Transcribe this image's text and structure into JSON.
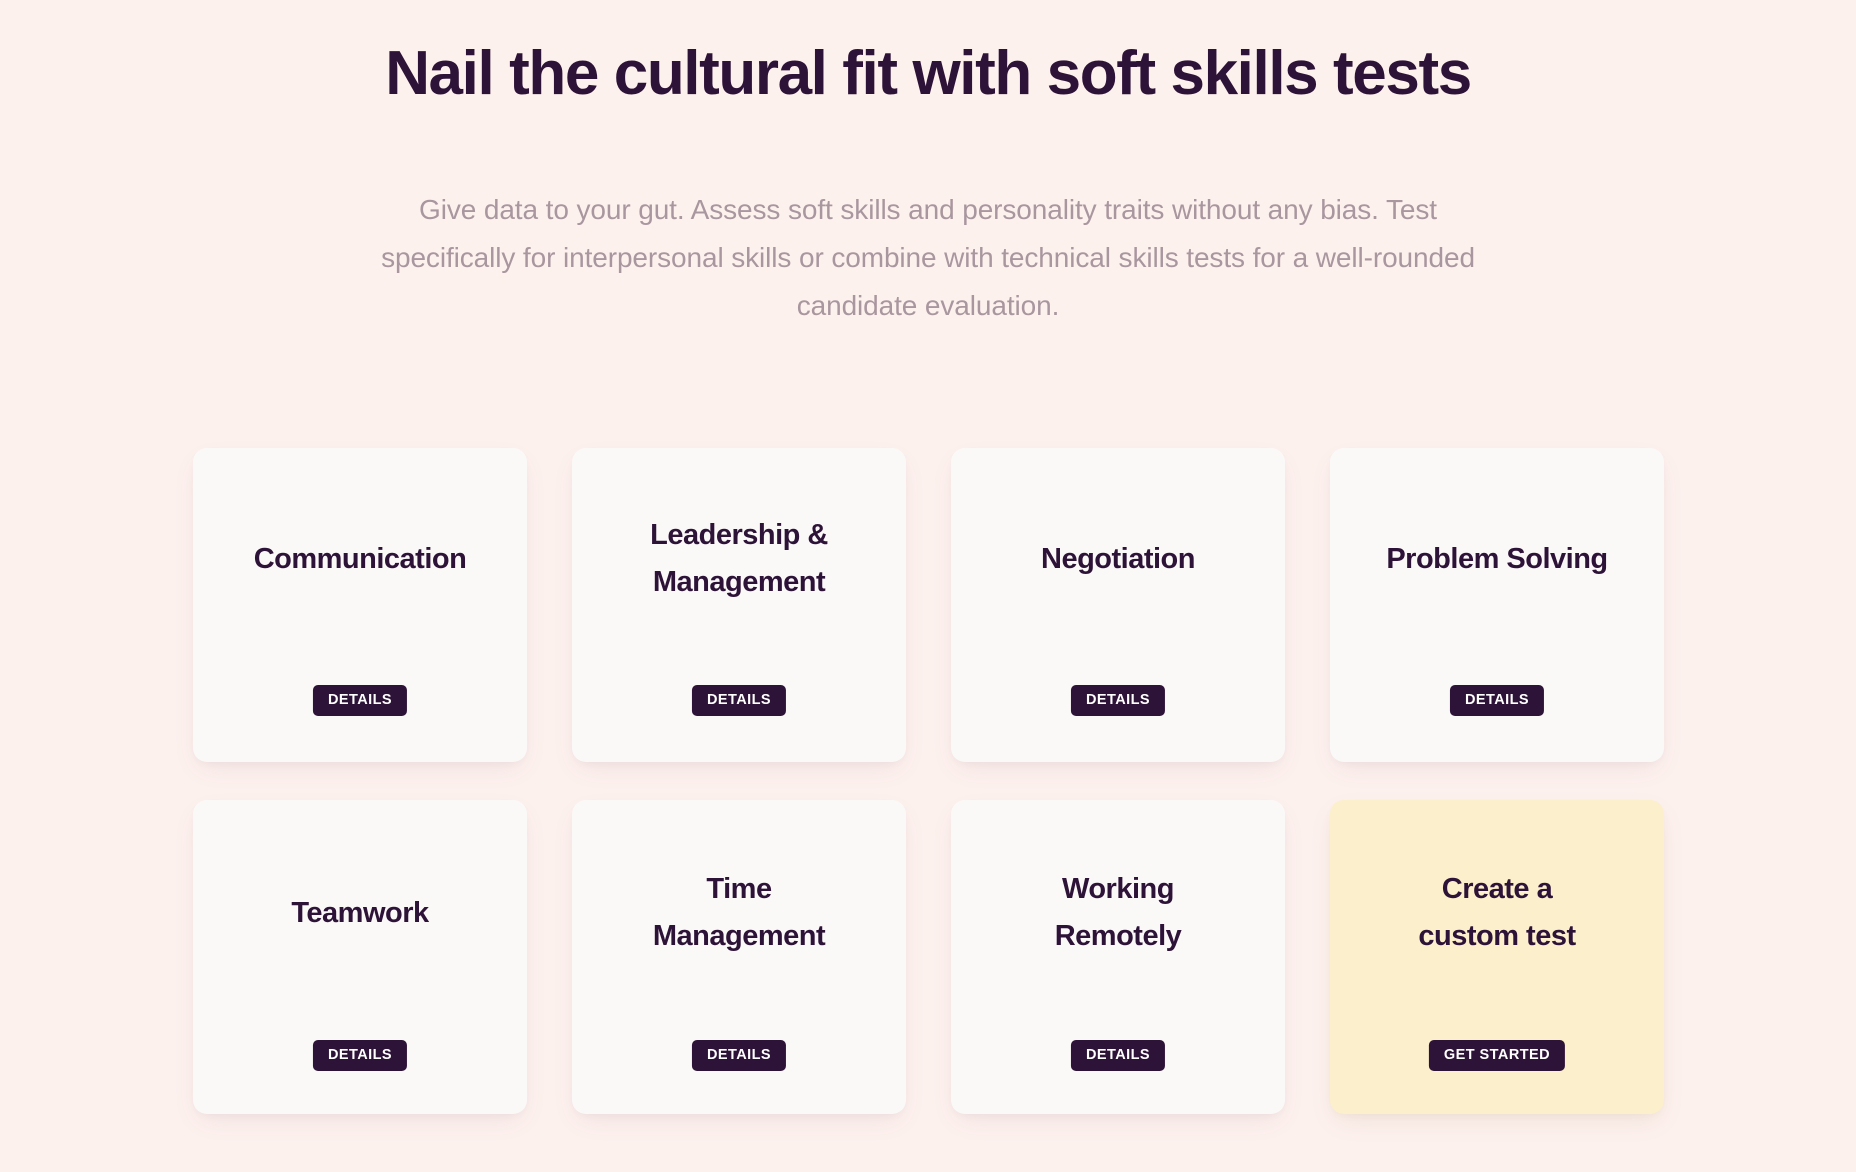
{
  "hero": {
    "title": "Nail the cultural fit with soft skills tests",
    "subtitle": "Give data to your gut. Assess soft skills and personality traits without any bias. Test specifically for interpersonal skills or combine with technical skills tests for a well-rounded candidate evaluation."
  },
  "colors": {
    "page_background": "#fdf1ee",
    "card_background": "#fbf9f8",
    "highlight_card_background": "#fcefcb",
    "heading_text": "#2e1338",
    "subtitle_text": "#a9979f",
    "button_background": "#2e1338",
    "button_text": "#ffffff"
  },
  "cards": [
    {
      "title": "Communication",
      "button": "DETAILS",
      "highlight": false
    },
    {
      "title": "Leadership &\nManagement",
      "button": "DETAILS",
      "highlight": false
    },
    {
      "title": "Negotiation",
      "button": "DETAILS",
      "highlight": false
    },
    {
      "title": "Problem Solving",
      "button": "DETAILS",
      "highlight": false
    },
    {
      "title": "Teamwork",
      "button": "DETAILS",
      "highlight": false
    },
    {
      "title": "Time\nManagement",
      "button": "DETAILS",
      "highlight": false
    },
    {
      "title": "Working\nRemotely",
      "button": "DETAILS",
      "highlight": false
    },
    {
      "title": "Create a\ncustom test",
      "button": "GET STARTED",
      "highlight": true
    }
  ]
}
